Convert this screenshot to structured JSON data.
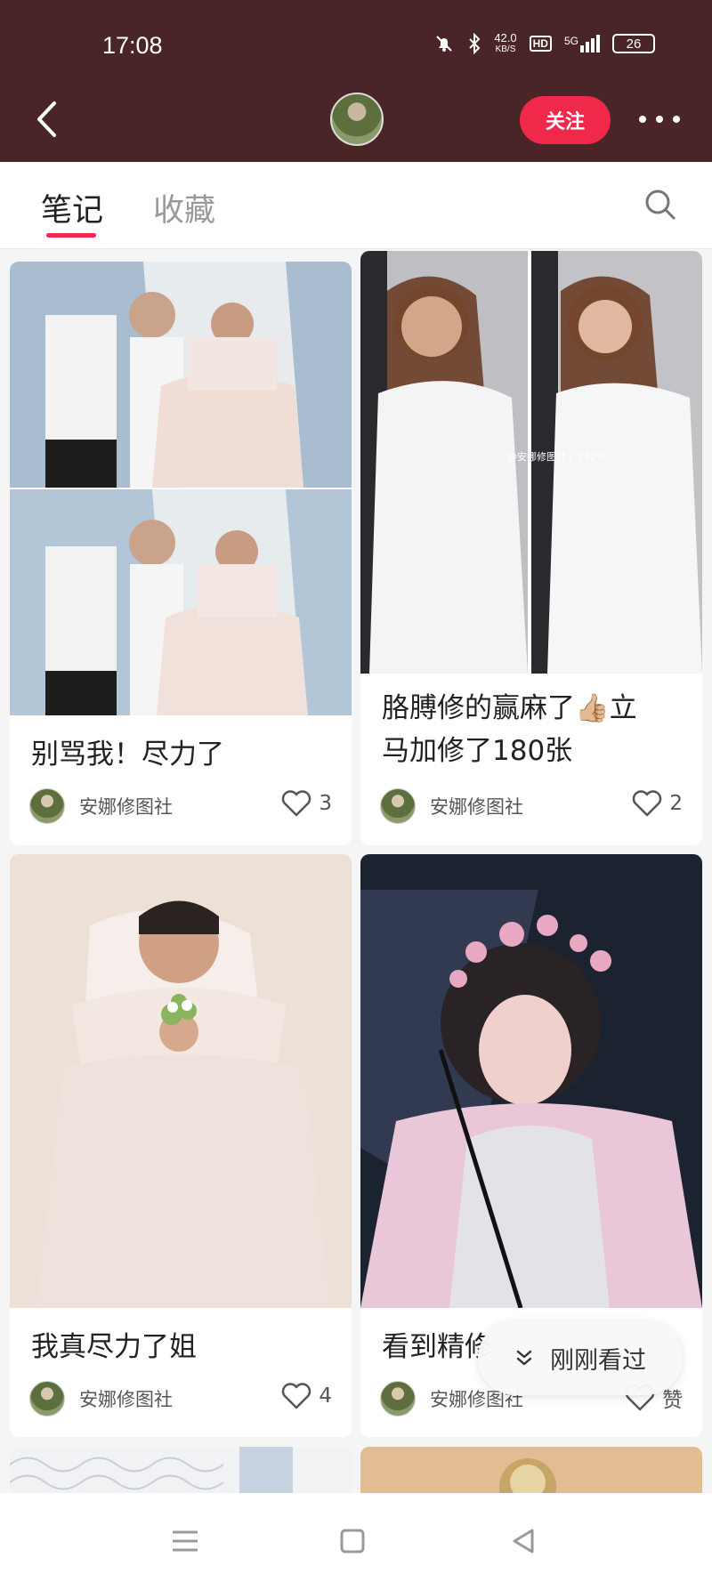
{
  "status_bar": {
    "time": "17:08",
    "net_speed_value": "42.0",
    "net_speed_unit": "KB/S",
    "hd": "HD",
    "signal": "5G",
    "battery": "26"
  },
  "header": {
    "follow_label": "关注"
  },
  "tabs": [
    {
      "label": "笔记",
      "active": true
    },
    {
      "label": "收藏",
      "active": false
    }
  ],
  "notes": [
    {
      "title": "别骂我！尽力了",
      "author": "安娜修图社",
      "likes": "3"
    },
    {
      "title_line1": "胳膊修的赢麻了👍🏼立",
      "title_line2": "马加修了180张",
      "author": "安娜修图社",
      "likes": "2",
      "watermark": "@安娜修图社 | 小红书"
    },
    {
      "title": "我真尽力了姐",
      "author": "安娜修图社",
      "likes": "4"
    },
    {
      "title": "看到精修",
      "author": "安娜修图社",
      "likes": "赞"
    }
  ],
  "recent_pill": {
    "label": "刚刚看过"
  },
  "colors": {
    "header_bg": "#4a2528",
    "accent": "#f0284a"
  }
}
